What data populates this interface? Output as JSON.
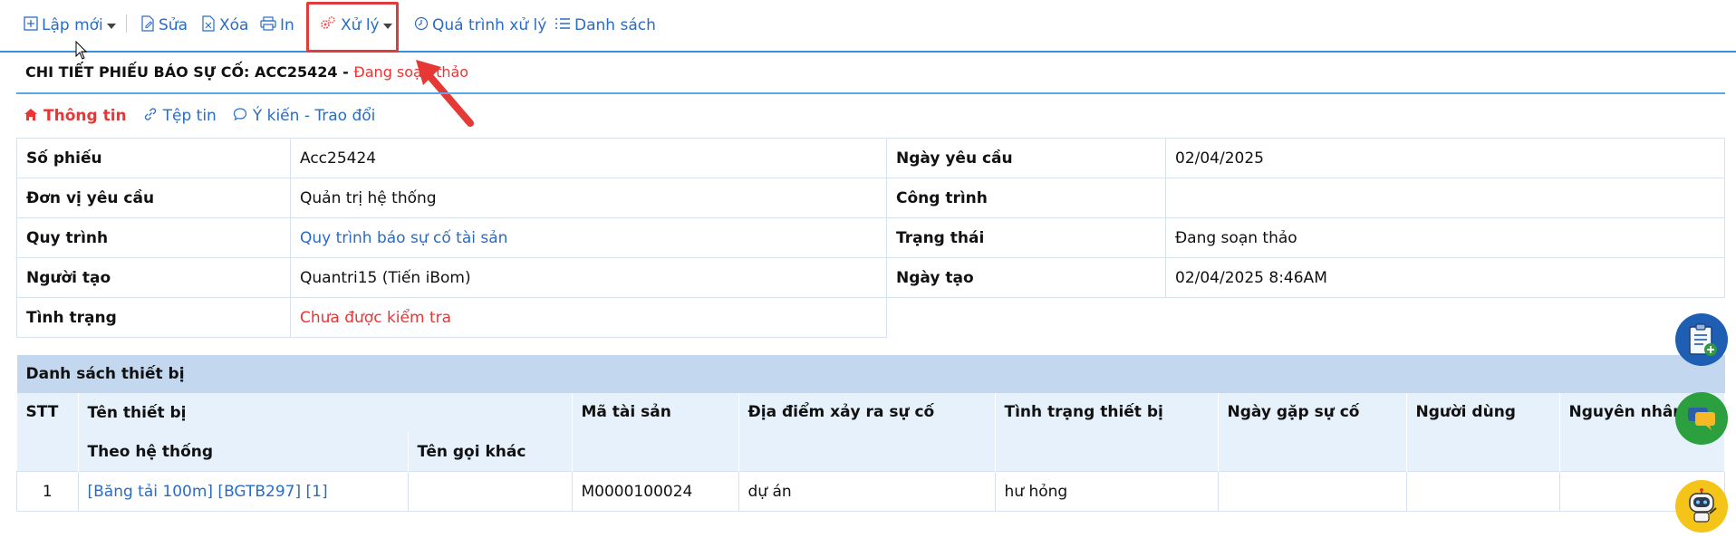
{
  "toolbar": {
    "new_label": "Lập mới",
    "edit_label": "Sửa",
    "delete_label": "Xóa",
    "print_label": "In",
    "process_label": "Xử lý",
    "history_label": "Quá trình xử lý",
    "list_label": "Danh sách"
  },
  "header": {
    "title": "CHI TIẾT PHIẾU BÁO SỰ CỐ: ACC25424 - ",
    "status": "Đang soạn thảo"
  },
  "tabs": [
    {
      "label": "Thông tin"
    },
    {
      "label": "Tệp tin"
    },
    {
      "label": "Ý kiến - Trao đổi"
    }
  ],
  "info": {
    "so_phieu_label": "Số phiếu",
    "so_phieu": "Acc25424",
    "ngay_yc_label": "Ngày yêu cầu",
    "ngay_yc": "02/04/2025",
    "don_vi_label": "Đơn vị yêu cầu",
    "don_vi": "Quản trị hệ thống",
    "cong_trinh_label": "Công trình",
    "cong_trinh": "",
    "quy_trinh_label": "Quy trình",
    "quy_trinh": "Quy trình báo sự cố tài sản",
    "trang_thai_label": "Trạng thái",
    "trang_thai": "Đang soạn thảo",
    "nguoi_tao_label": "Người tạo",
    "nguoi_tao": "Quantri15 (Tiến iBom)",
    "ngay_tao_label": "Ngày tạo",
    "ngay_tao": "02/04/2025 8:46AM",
    "tinh_trang_label": "Tình trạng",
    "tinh_trang": "Chưa được kiểm tra"
  },
  "equipment": {
    "section_title": "Danh sách thiết bị",
    "columns": {
      "stt": "STT",
      "ten_thiet_bi": "Tên thiết bị",
      "theo_he_thong": "Theo hệ thống",
      "ten_goi_khac": "Tên gọi khác",
      "ma_tai_san": "Mã tài sản",
      "dia_diem": "Địa điểm xảy ra sự cố",
      "tinh_trang_tb": "Tình trạng thiết bị",
      "ngay_gap": "Ngày gặp sự cố",
      "nguoi_dung": "Người dùng",
      "nguyen_nhan": "Nguyên nhân"
    },
    "rows": [
      {
        "stt": "1",
        "theo_he_thong": "[Băng tải 100m] [BGTB297] [1]",
        "ten_goi_khac": "",
        "ma_tai_san": "M0000100024",
        "dia_diem": "dự án",
        "tinh_trang_tb": "hư hỏng",
        "ngay_gap": "",
        "nguoi_dung": "",
        "nguyen_nhan": ""
      }
    ]
  },
  "colors": {
    "accent": "#2a6cc4",
    "status_red": "#e33333",
    "section_header": "#c3d8ef",
    "column_header": "#e6f1fc"
  },
  "icons": [
    "plus-square-icon",
    "edit-doc-icon",
    "delete-doc-icon",
    "printer-icon",
    "gears-icon",
    "clock-icon",
    "list-icon",
    "home-icon",
    "link-icon",
    "comment-icon",
    "clipboard-add-icon",
    "chat-icon",
    "robot-icon"
  ]
}
